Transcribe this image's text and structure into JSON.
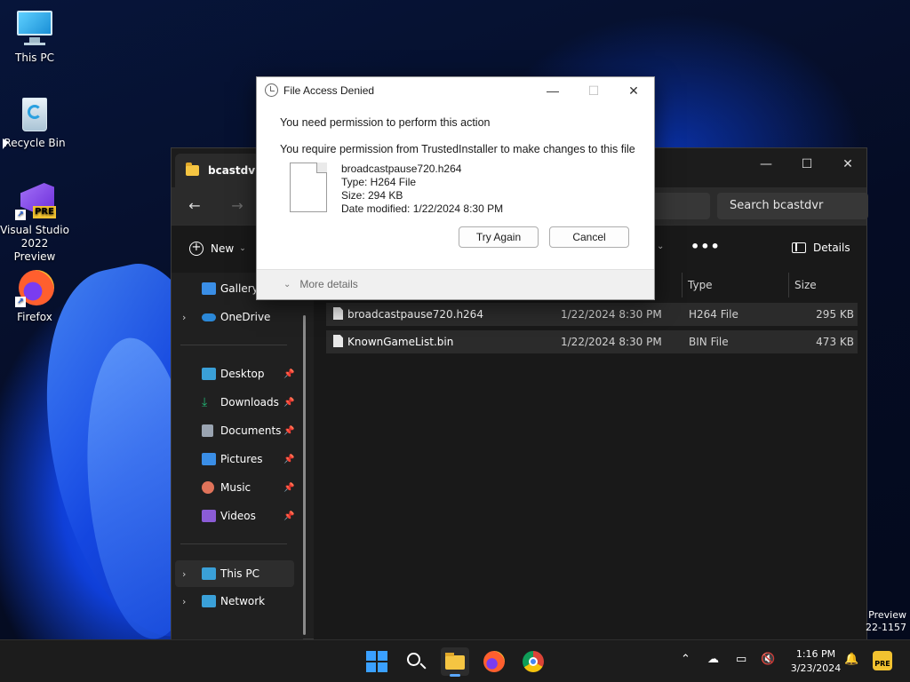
{
  "desktop": {
    "icons": [
      {
        "label": "This PC"
      },
      {
        "label": "Recycle Bin"
      },
      {
        "label": "Visual Studio 2022 Preview",
        "badge": "PRE"
      },
      {
        "label": "Firefox"
      }
    ],
    "watermark": {
      "line1": "Preview",
      "line2": "22-1157"
    }
  },
  "explorer": {
    "tab_title": "bcastdvr",
    "search_placeholder": "Search bcastdvr",
    "toolbar": {
      "new_label": "New",
      "more_label": "•••",
      "details_label": "Details"
    },
    "sidebar": {
      "items": [
        {
          "label": "Gallery",
          "icon": "gallery-icon",
          "color": "#3a8ee6"
        },
        {
          "label": "OneDrive",
          "icon": "onedrive-icon",
          "color": "#2b88d8"
        },
        {
          "label": "Desktop",
          "icon": "desktop-icon",
          "color": "#3aa0d8"
        },
        {
          "label": "Downloads",
          "icon": "download-icon",
          "color": "#22b573"
        },
        {
          "label": "Documents",
          "icon": "documents-icon",
          "color": "#9aa4b1"
        },
        {
          "label": "Pictures",
          "icon": "pictures-icon",
          "color": "#3a8ee6"
        },
        {
          "label": "Music",
          "icon": "music-icon",
          "color": "#e0735a"
        },
        {
          "label": "Videos",
          "icon": "videos-icon",
          "color": "#8b5cd6"
        },
        {
          "label": "This PC",
          "icon": "this-pc-icon",
          "color": "#3aa0d8"
        },
        {
          "label": "Network",
          "icon": "network-icon",
          "color": "#3aa0d8"
        }
      ]
    },
    "columns": {
      "type": "Type",
      "size": "Size"
    },
    "files": [
      {
        "name": "broadcastpause720.h264",
        "date": "1/22/2024 8:30 PM",
        "type": "H264 File",
        "size": "295 KB"
      },
      {
        "name": "KnownGameList.bin",
        "date": "1/22/2024 8:30 PM",
        "type": "BIN File",
        "size": "473 KB"
      }
    ]
  },
  "dialog": {
    "title": "File Access Denied",
    "message1": "You need permission to perform this action",
    "message2": "You require permission from TrustedInstaller to make changes to this file",
    "file": {
      "name": "broadcastpause720.h264",
      "type": "Type: H264 File",
      "size": "Size: 294 KB",
      "modified": "Date modified: 1/22/2024 8:30 PM"
    },
    "try_again_label": "Try Again",
    "cancel_label": "Cancel",
    "more_details_label": "More details"
  },
  "taskbar": {
    "time": "1:16 PM",
    "date": "3/23/2024",
    "tray_badge": "PRE"
  }
}
